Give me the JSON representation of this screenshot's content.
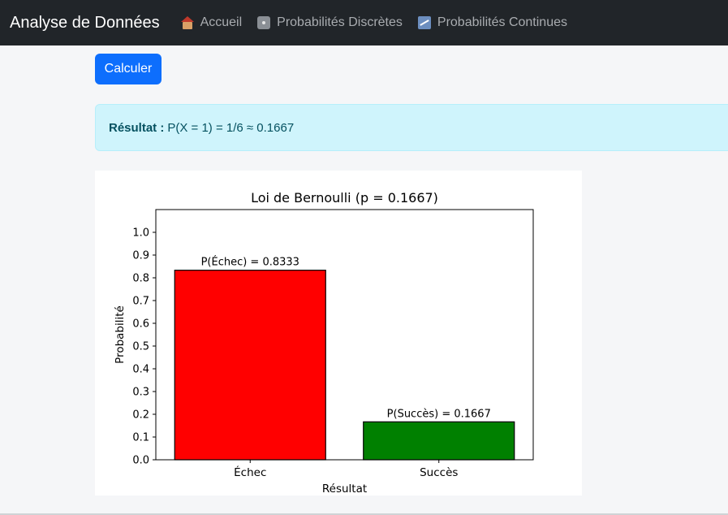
{
  "navbar": {
    "brand": "Analyse de Données",
    "links": [
      {
        "label": "Accueil",
        "icon": "house-icon"
      },
      {
        "label": "Probabilités Discrètes",
        "icon": "dice-icon"
      },
      {
        "label": "Probabilités Continues",
        "icon": "chart-icon"
      }
    ]
  },
  "actions": {
    "calculate_label": "Calculer"
  },
  "result": {
    "label": "Résultat :",
    "text": "P(X = 1) = 1/6 ≈ 0.1667"
  },
  "chart_data": {
    "type": "bar",
    "title": "Loi de Bernoulli (p = 0.1667)",
    "xlabel": "Résultat",
    "ylabel": "Probabilité",
    "categories": [
      "Échec",
      "Succès"
    ],
    "values": [
      0.8333,
      0.1667
    ],
    "bar_labels": [
      "P(Échec) = 0.8333",
      "P(Succès) = 0.1667"
    ],
    "colors": [
      "#ff0000",
      "#008000"
    ],
    "ylim": [
      0,
      1.1
    ],
    "yticks": [
      "0.0",
      "0.1",
      "0.2",
      "0.3",
      "0.4",
      "0.5",
      "0.6",
      "0.7",
      "0.8",
      "0.9",
      "1.0"
    ],
    "grid": false
  }
}
